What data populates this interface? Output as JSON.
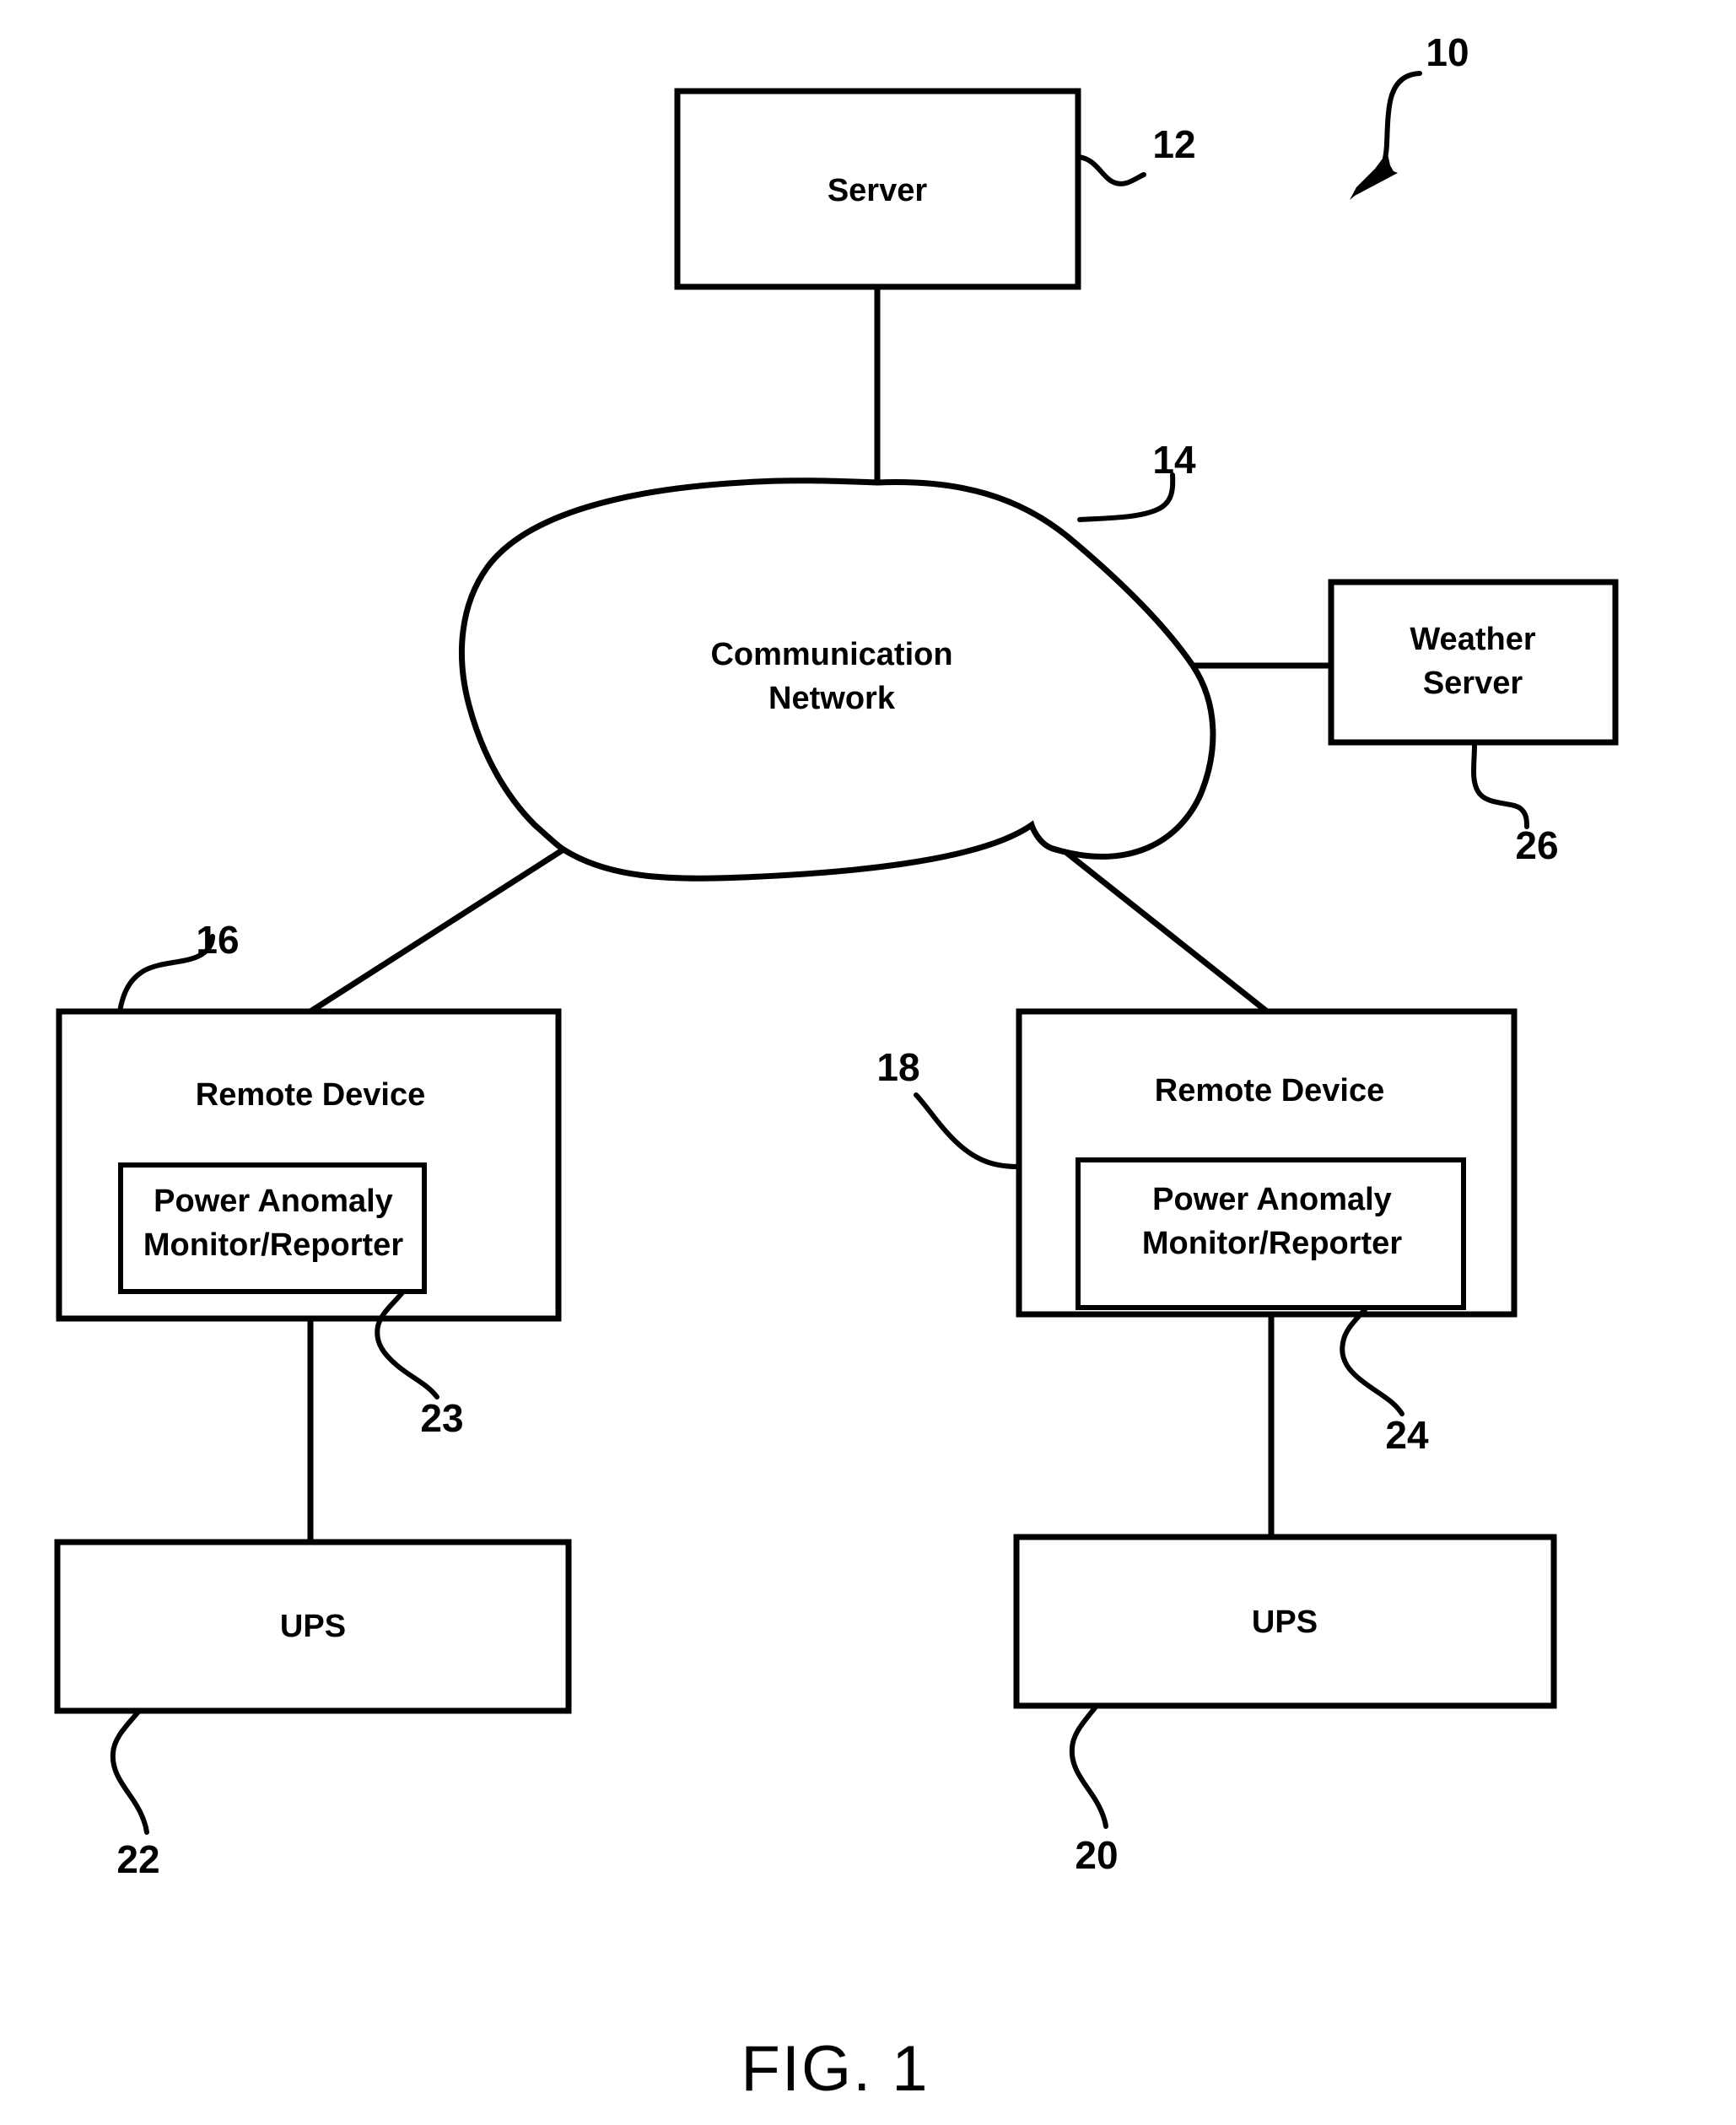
{
  "figure": {
    "caption": "FIG. 1",
    "system_numeral": "10"
  },
  "nodes": {
    "server": {
      "label": "Server",
      "numeral": "12"
    },
    "network": {
      "label_line1": "Communication",
      "label_line2": "Network",
      "numeral": "14"
    },
    "weather_server": {
      "label_line1": "Weather",
      "label_line2": "Server",
      "numeral": "26"
    },
    "remote_device_left": {
      "label": "Remote Device",
      "numeral": "16",
      "module": {
        "label_line1": "Power Anomaly",
        "label_line2": "Monitor/Reporter",
        "numeral": "23"
      }
    },
    "remote_device_right": {
      "label": "Remote Device",
      "numeral": "18",
      "module": {
        "label_line1": "Power Anomaly",
        "label_line2": "Monitor/Reporter",
        "numeral": "24"
      }
    },
    "ups_left": {
      "label": "UPS",
      "numeral": "22"
    },
    "ups_right": {
      "label": "UPS",
      "numeral": "20"
    }
  },
  "colors": {
    "stroke": "#000000",
    "background": "#ffffff"
  }
}
